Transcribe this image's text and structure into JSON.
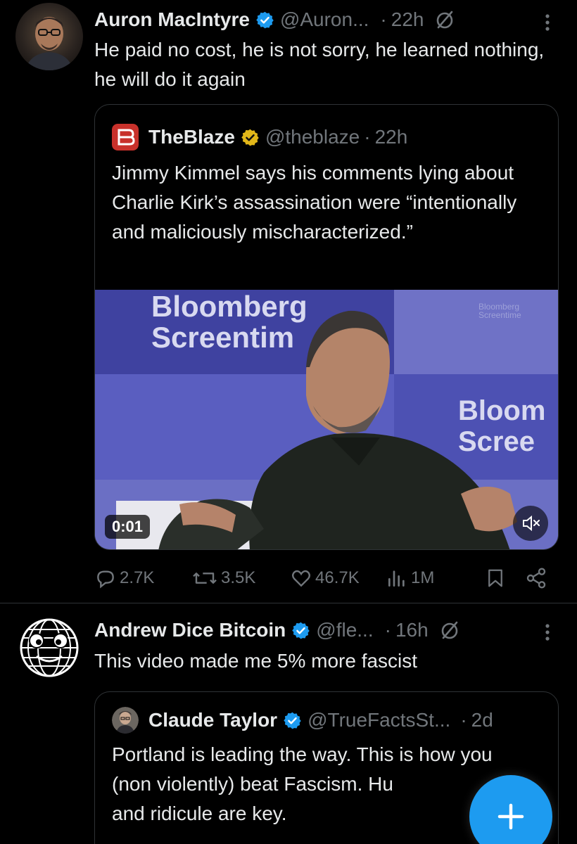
{
  "posts": [
    {
      "author": "Auron MacIntyre",
      "handle": "@Auron...",
      "time": "22h",
      "text": "He paid no cost, he is not sorry, he learned nothing, he will do it again",
      "quote": {
        "author": "TheBlaze",
        "handle": "@theblaze",
        "time": "22h",
        "text": "Jimmy Kimmel says his comments lying about Charlie Kirk’s assassination were “intentionally and maliciously mischaracterized.”",
        "video": {
          "duration": "0:01",
          "backdrop_brand": "Bloomberg",
          "backdrop_show": "Screentim",
          "backdrop_brand_right": "Bloom",
          "backdrop_show_right": "Scree",
          "small_brand": "Bloomberg",
          "small_show": "Screentime"
        }
      },
      "stats": {
        "replies": "2.7K",
        "reposts": "3.5K",
        "likes": "46.7K",
        "views": "1M"
      }
    },
    {
      "author": "Andrew Dice Bitcoin",
      "handle": "@fle...",
      "time": "16h",
      "text": "This video made me 5% more fascist",
      "quote": {
        "author": "Claude Taylor",
        "handle": "@TrueFactsSt...",
        "time": "2d",
        "text": "Portland is leading the way. This is how you (non violently) beat Fascism. Hu",
        "text_line3": "and ridicule are key."
      }
    }
  ],
  "colors": {
    "background": "#000000",
    "text": "#e7e9ea",
    "muted": "#71767b",
    "verified_blue": "#1d9bf0",
    "verified_gold": "#e2b719",
    "blaze_red": "#c8312b",
    "fab": "#1d9bf0"
  },
  "icons": {
    "more": "more-vertical-icon",
    "grok": "grok-icon",
    "reply": "reply-icon",
    "repost": "repost-icon",
    "like": "like-icon",
    "views": "views-icon",
    "bookmark": "bookmark-icon",
    "share": "share-icon",
    "mute": "mute-icon",
    "compose": "plus-icon"
  }
}
